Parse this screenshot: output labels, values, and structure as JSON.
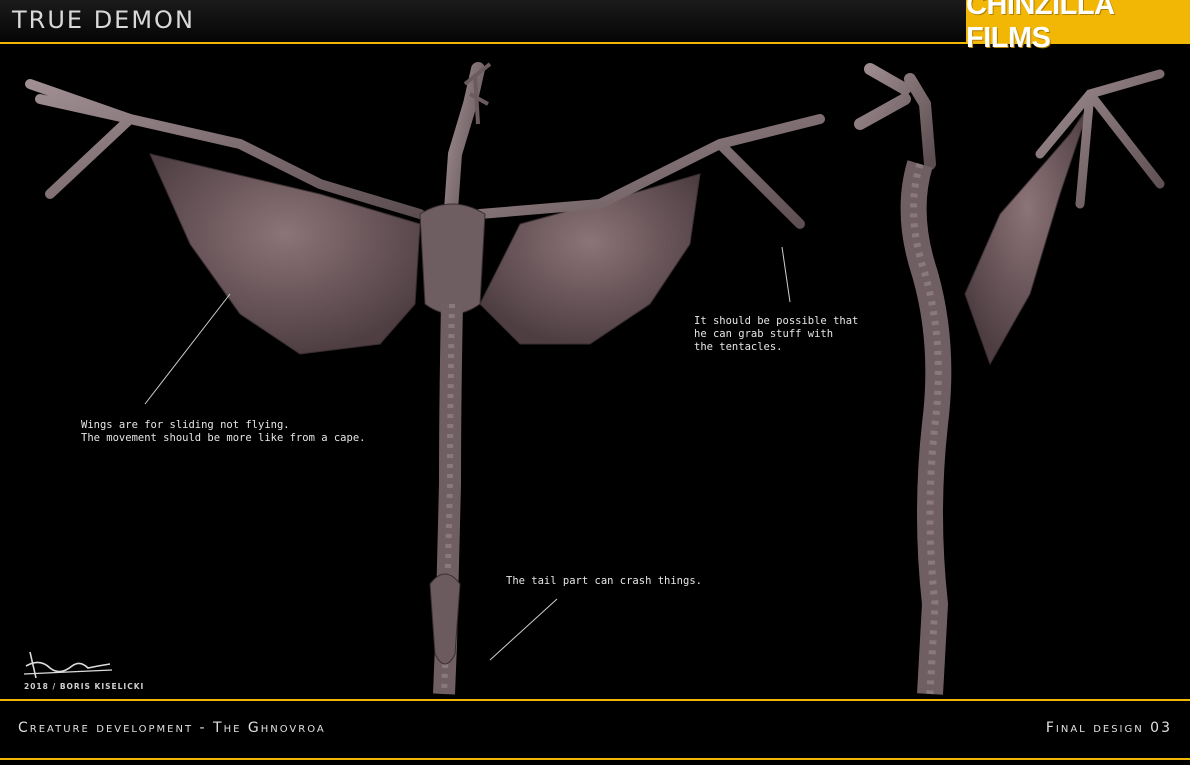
{
  "header": {
    "title": "TRUE DEMON",
    "brand": "CHINZILLA FILMS"
  },
  "notes": {
    "wings": "Wings are for sliding not flying.\nThe movement should be more like from a cape.",
    "tentacles": "It should be possible that\nhe can grab stuff with\nthe tentacles.",
    "tail": "The tail part can crash things."
  },
  "signature": {
    "caption": "2018 / BORIS KISELICKI"
  },
  "footer": {
    "left": "Creature development  -  The Ghnovroa",
    "right": "Final design 03"
  },
  "colors": {
    "accent": "#f2b705",
    "background": "#000000",
    "creature": "#7a6a6e"
  }
}
